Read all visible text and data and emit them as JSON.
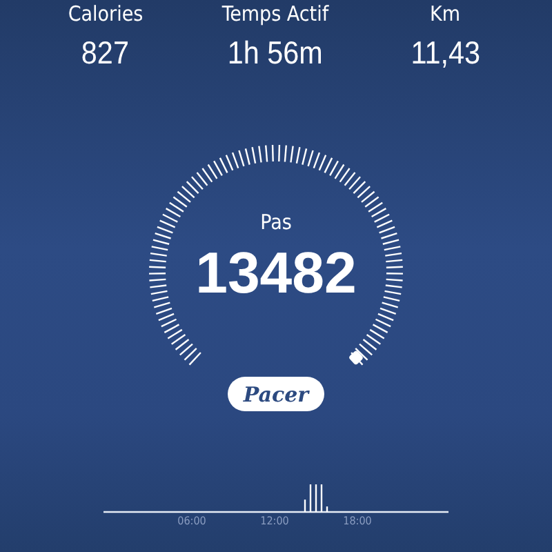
{
  "stats": [
    {
      "label": "Calories",
      "value": "827"
    },
    {
      "label": "Temps Actif",
      "value": "1h 56m"
    },
    {
      "label": "Km",
      "value": "11,43"
    }
  ],
  "steps": {
    "label": "Pas",
    "value": "13482"
  },
  "brand": "Pacer",
  "timeline": {
    "ticks": [
      "06:00",
      "12:00",
      "18:00"
    ]
  }
}
